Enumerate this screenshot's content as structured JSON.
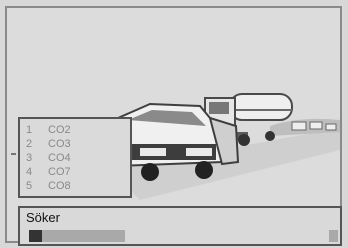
{
  "channel_list": {
    "items": [
      {
        "number": "1",
        "name": "CO2"
      },
      {
        "number": "2",
        "name": "CO3"
      },
      {
        "number": "3",
        "name": "CO4"
      },
      {
        "number": "4",
        "name": "CO7"
      },
      {
        "number": "5",
        "name": "CO8"
      }
    ]
  },
  "search": {
    "label": "Söker",
    "progress": 0.14
  },
  "colors": {
    "background": "#d8d8d8",
    "text": "#111111",
    "muted_text": "#8a8a8a",
    "progress_fill": "#333333",
    "progress_track": "#a9a9a9"
  }
}
